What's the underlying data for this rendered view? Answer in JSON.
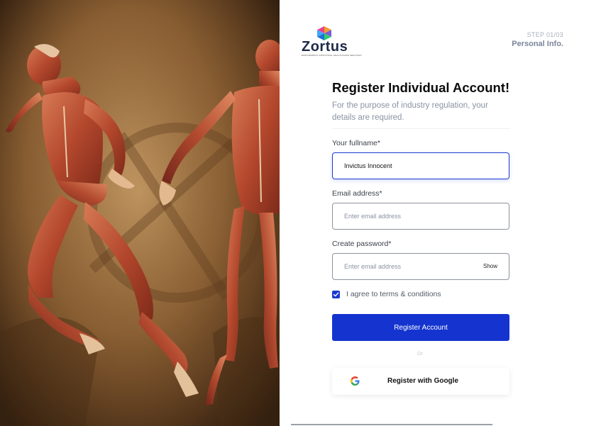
{
  "brand": {
    "name": "Zortus",
    "tagline": "EMPOWERING INDUSTRIAL HEALTHCARE SERVICES"
  },
  "step": {
    "counter": "STEP 01/03",
    "name": "Personal Info."
  },
  "form": {
    "title": "Register Individual Account!",
    "subtitle": "For the purpose of industry regulation, your details are required.",
    "fullname": {
      "label": "Your fullname*",
      "value": "Invictus Innocent"
    },
    "email": {
      "label": "Email address*",
      "placeholder": "Enter email address"
    },
    "password": {
      "label": "Create password*",
      "placeholder": "Enter email address",
      "toggle_label": "Show"
    },
    "terms": {
      "label": "I agree to terms & conditions",
      "checked": true
    },
    "submit_label": "Register Account",
    "separator": "Or",
    "google_label": "Register with Google"
  },
  "colors": {
    "primary": "#1534cf",
    "title": "#0b0b0b",
    "muted": "#8a93a3",
    "hero_bg": "#8a5f33"
  },
  "icons": {
    "logo": "zortus-logo-icon",
    "check": "check-icon",
    "google": "google-g-icon"
  }
}
